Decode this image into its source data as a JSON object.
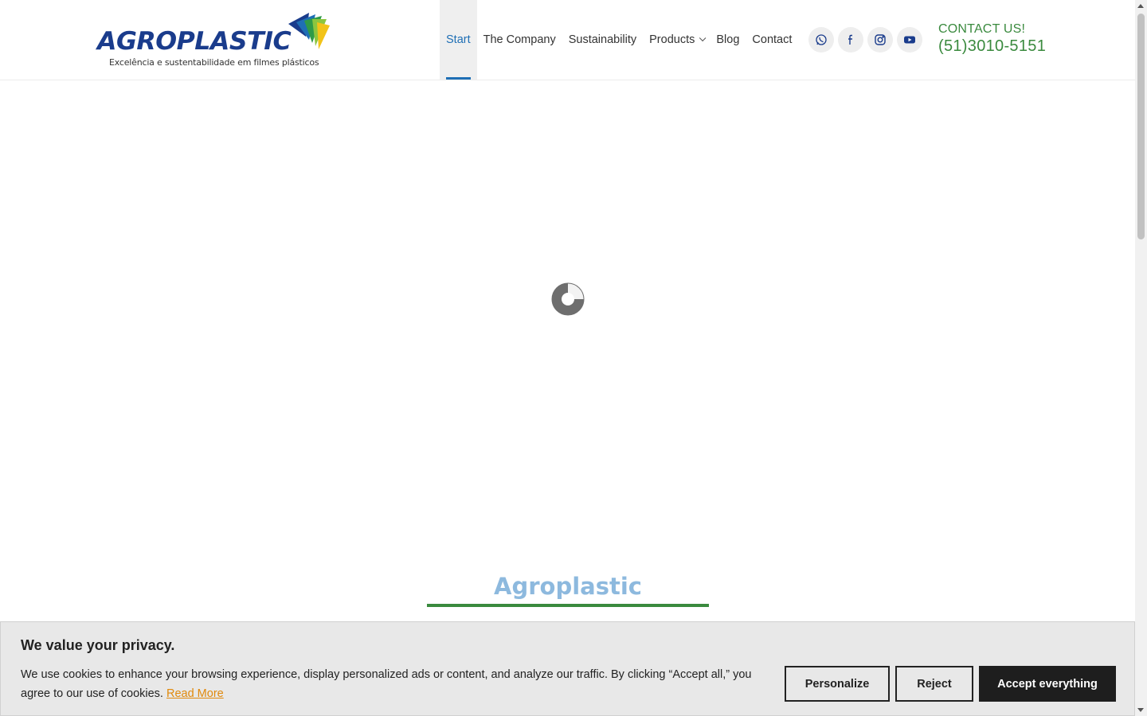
{
  "header": {
    "logo": {
      "word": "AGROPLASTIC",
      "tagline": "Excelência e sustentabilidade em filmes plásticos"
    },
    "nav": [
      {
        "label": "Start",
        "active": true
      },
      {
        "label": "The Company"
      },
      {
        "label": "Sustainability"
      },
      {
        "label": "Products",
        "has_dropdown": true
      },
      {
        "label": "Blog"
      },
      {
        "label": "Contact"
      }
    ],
    "social": [
      "whatsapp-icon",
      "facebook-icon",
      "instagram-icon",
      "youtube-icon"
    ],
    "contact": {
      "label": "CONTACT US!",
      "phone": "(51)3010-5151"
    }
  },
  "main": {
    "section_title": "Agroplastic"
  },
  "cookie": {
    "title": "We value your privacy.",
    "text": "We use cookies to enhance your browsing experience, display personalized ads or content, and analyze our traffic. By clicking “Accept all,” you agree to our use of cookies.",
    "read_more": "Read More",
    "buttons": {
      "personalize": "Personalize",
      "reject": "Reject",
      "accept": "Accept everything"
    }
  },
  "colors": {
    "brand_blue": "#1f6fb5",
    "brand_green": "#3a8a3e",
    "title_light_blue": "#8db9de",
    "link_orange": "#e0890c"
  }
}
